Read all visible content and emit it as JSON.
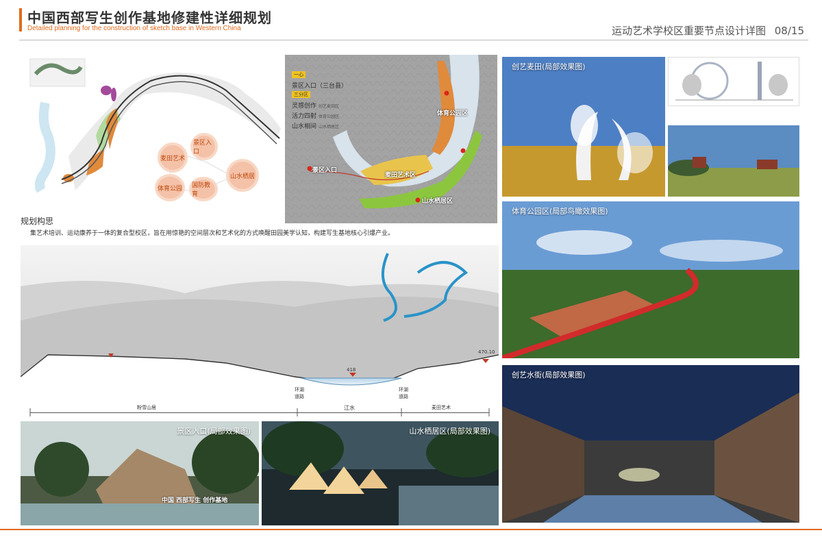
{
  "header": {
    "title_cn": "中国西部写生创作基地修建性详细规划",
    "title_en": "Detailed planning for the construction of sketch base in Western China",
    "subtitle": "运动艺术学校区重要节点设计详图",
    "page": "08/15"
  },
  "masterplan": {
    "nodes": [
      "景区入口",
      "麦田艺术",
      "山水栖居",
      "体育公园",
      "国防教育"
    ]
  },
  "aerial": {
    "legend_one_tag": "一心",
    "legend_one": "景区入口（三台县）",
    "legend_three_tag": "三分区",
    "zones": [
      {
        "label": "灵感创作",
        "sub": "创艺麦田区"
      },
      {
        "label": "活力四射",
        "sub": "体育公园区"
      },
      {
        "label": "山水相间",
        "sub": "山水栖居区"
      }
    ],
    "map_labels": {
      "sports": "体育公园区",
      "entrance": "景区入口",
      "wheat": "麦田艺术区",
      "living": "山水栖居区"
    }
  },
  "concept": {
    "title": "规划构思",
    "body": "集艺术培训、运动康养于一体的复合型校区，旨在用惊艳的空间层次和艺术化的方式唤醒田园美学认知，构建写生基地核心引爆产业。"
  },
  "section": {
    "elev_left": "",
    "elev_water": "418",
    "elev_right": "470.10",
    "road_left": "环湖\n道路",
    "road_right": "环湖\n道路",
    "dims": [
      "粉雪山居",
      "江水",
      "麦田艺术"
    ]
  },
  "photos": {
    "wheat": "创艺麦田(局部效果图)",
    "park": "体育公园区(局部鸟瞰效果图)",
    "street": "创艺水街(局部效果图)",
    "gate": "景区入口(局部效果图)",
    "cabins": "山水栖居区(局部效果图)",
    "gate_sign": "中国 西部写生 创作基地"
  },
  "colors": {
    "accent": "#e06a1c",
    "zone_orange": "#e08a3c",
    "zone_yellow": "#e9c44c",
    "zone_green": "#8cc63f",
    "river": "#2a93c9"
  }
}
